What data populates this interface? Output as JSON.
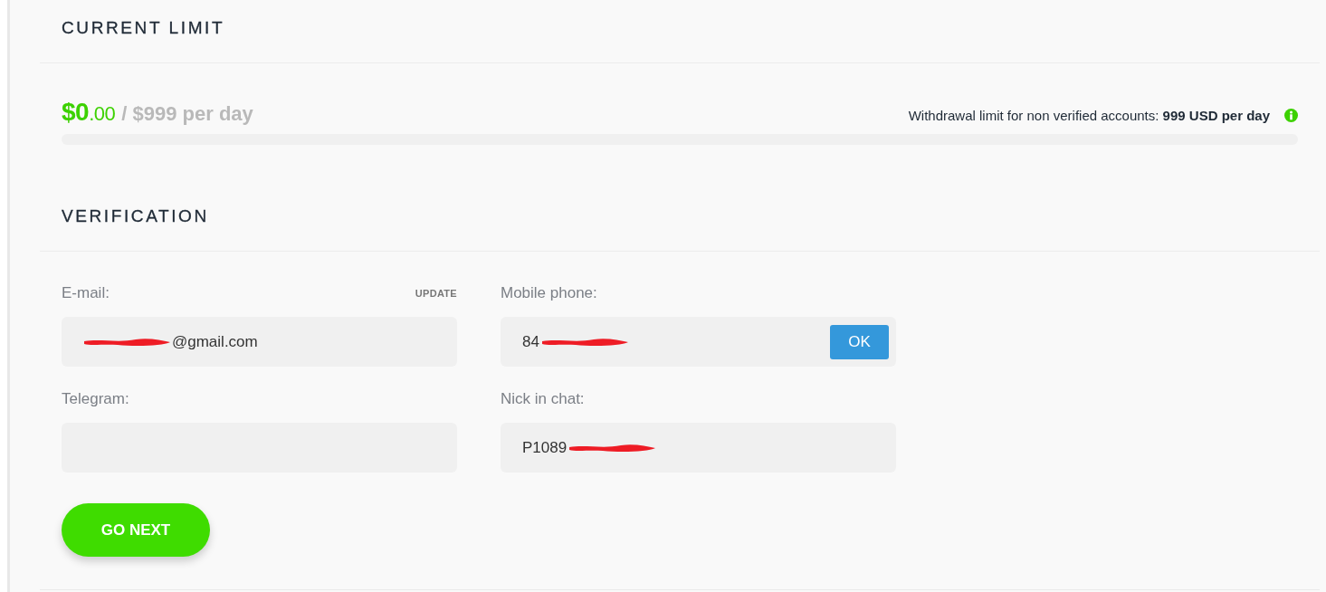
{
  "current_limit": {
    "heading": "CURRENT LIMIT",
    "used": "$0",
    "used_cents": ".00",
    "limit": "/ $999 per day",
    "level": 0,
    "note": "Withdrawal limit for non verified accounts: **999 USD per day**"
  },
  "verification": {
    "heading": "VERIFICATION",
    "fields": [
      {
        "label": "E-mail:",
        "action": "UPDATE",
        "value": "@gmail.com",
        "masked_before": true
      },
      {
        "label": "Mobile phone:",
        "value": "84",
        "masked_after": true,
        "button": "OK"
      },
      {
        "label": "Telegram:"
      },
      {
        "label": "Nick in chat:",
        "value": "P1089",
        "masked_after": true
      }
    ],
    "submit": "GO NEXT"
  }
}
